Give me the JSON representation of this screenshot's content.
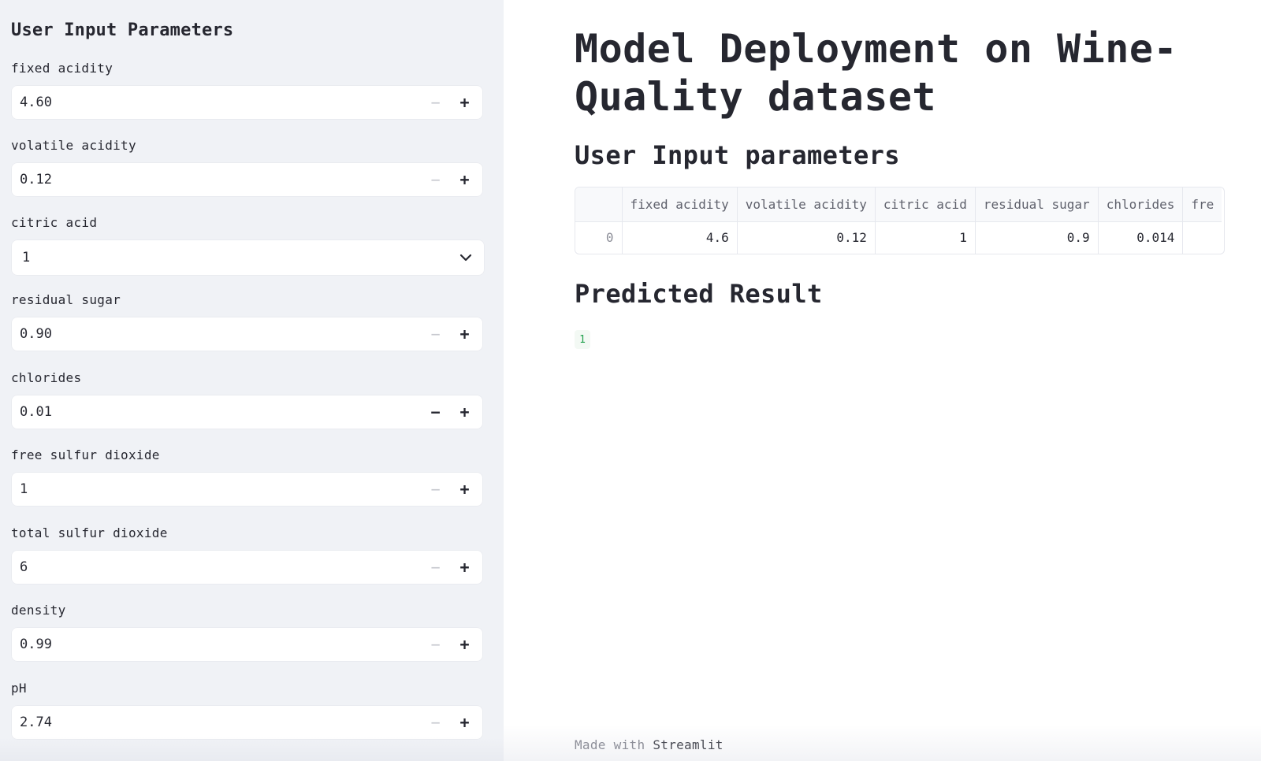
{
  "sidebar": {
    "title": "User Input Parameters",
    "fields": [
      {
        "label": "fixed acidity",
        "value": "4.60",
        "type": "number",
        "minus_disabled": true
      },
      {
        "label": "volatile acidity",
        "value": "0.12",
        "type": "number",
        "minus_disabled": true
      },
      {
        "label": "citric acid",
        "value": "1",
        "type": "select"
      },
      {
        "label": "residual sugar",
        "value": "0.90",
        "type": "number",
        "minus_disabled": true
      },
      {
        "label": "chlorides",
        "value": "0.01",
        "type": "number",
        "minus_disabled": false
      },
      {
        "label": "free sulfur dioxide",
        "value": "1",
        "type": "number",
        "minus_disabled": true
      },
      {
        "label": "total sulfur dioxide",
        "value": "6",
        "type": "number",
        "minus_disabled": true
      },
      {
        "label": "density",
        "value": "0.99",
        "type": "number",
        "minus_disabled": true
      },
      {
        "label": "pH",
        "value": "2.74",
        "type": "number",
        "minus_disabled": true
      }
    ],
    "minus_glyph": "−",
    "plus_glyph": "+"
  },
  "main": {
    "title": "Model Deployment on Wine-Quality dataset",
    "inputs_heading": "User Input parameters",
    "table": {
      "columns": [
        "",
        "fixed acidity",
        "volatile acidity",
        "citric acid",
        "residual sugar",
        "chlorides",
        "fre"
      ],
      "rows": [
        [
          "0",
          "4.6",
          "0.12",
          "1",
          "0.9",
          "0.014",
          ""
        ]
      ]
    },
    "result_heading": "Predicted Result",
    "result_value": "1"
  },
  "footer": {
    "prefix": "Made with ",
    "link": "Streamlit"
  },
  "colors": {
    "sidebar_bg": "#f0f2f6",
    "text": "#262730",
    "result_green": "#21a14d"
  }
}
